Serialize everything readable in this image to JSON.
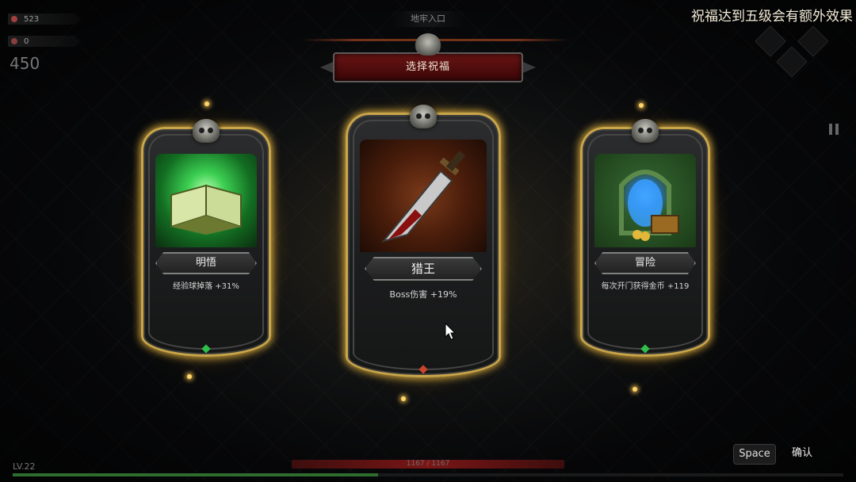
{
  "hud": {
    "gold": "523",
    "kills": "0",
    "score": "450"
  },
  "area_name": "地牢入口",
  "title": "选择祝福",
  "hint": "祝福达到五级会有额外效果",
  "cards": [
    {
      "name": "明悟",
      "desc": "经验球掉落 +31%",
      "art_icon": "glowing-book-icon",
      "accent": "#2fbf4a"
    },
    {
      "name": "猎王",
      "desc": "Boss伤害 +19%",
      "art_icon": "bloody-dagger-icon",
      "accent": "#c8442a"
    },
    {
      "name": "冒险",
      "desc": "每次开门获得金币 +119",
      "art_icon": "portal-treasure-icon",
      "accent": "#3aa0ff"
    }
  ],
  "footer": {
    "level": "LV.22",
    "hp": "1167 / 1167",
    "xp_fraction": 0.44,
    "space_key": "Space",
    "confirm": "确认"
  }
}
